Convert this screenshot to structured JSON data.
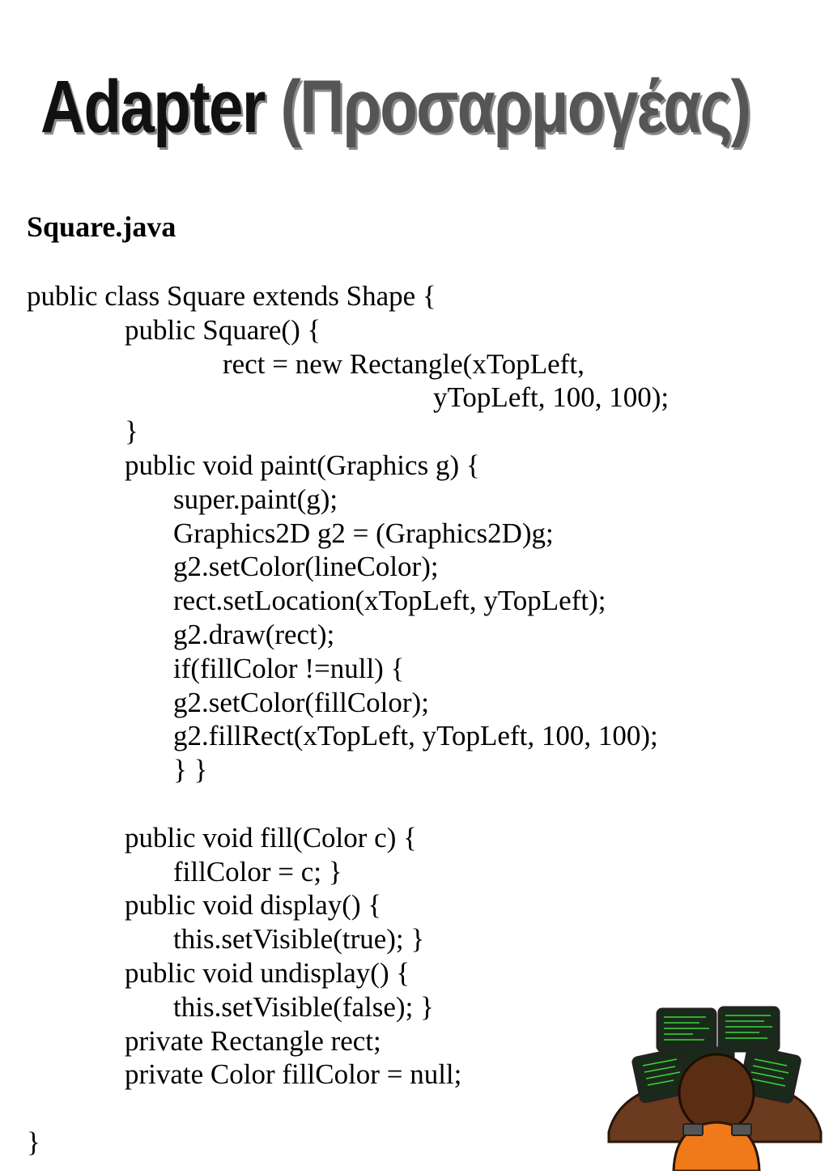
{
  "title": {
    "main": "Adapter",
    "paren": "(Προσαρμογέας)"
  },
  "filename": "Square.java",
  "code_lines": [
    "public class Square extends Shape {",
    "public Square() {",
    "rect = new Rectangle(xTopLeft,",
    "yTopLeft, 100, 100);",
    "}",
    "public void paint(Graphics g) {",
    "super.paint(g);",
    "Graphics2D g2 = (Graphics2D)g;",
    "g2.setColor(lineColor);",
    "rect.setLocation(xTopLeft, yTopLeft);",
    "g2.draw(rect);",
    "if(fillColor !=null) {",
    "g2.setColor(fillColor);",
    "g2.fillRect(xTopLeft, yTopLeft, 100, 100);",
    "} }",
    "",
    "public void fill(Color c) {",
    "fillColor = c; }",
    "public void display() {",
    "this.setVisible(true); }",
    "public void undisplay() {",
    "this.setVisible(false); }",
    "private Rectangle rect;",
    "private Color fillColor = null;",
    "",
    "}"
  ],
  "illustration": {
    "icon": "programmer-at-monitors-icon",
    "colors": {
      "desk": "#6b3a1f",
      "shirt": "#f07a1a",
      "hair": "#5a2e12",
      "screen": "#1a2a1a",
      "code_text": "#3fd13f"
    }
  }
}
